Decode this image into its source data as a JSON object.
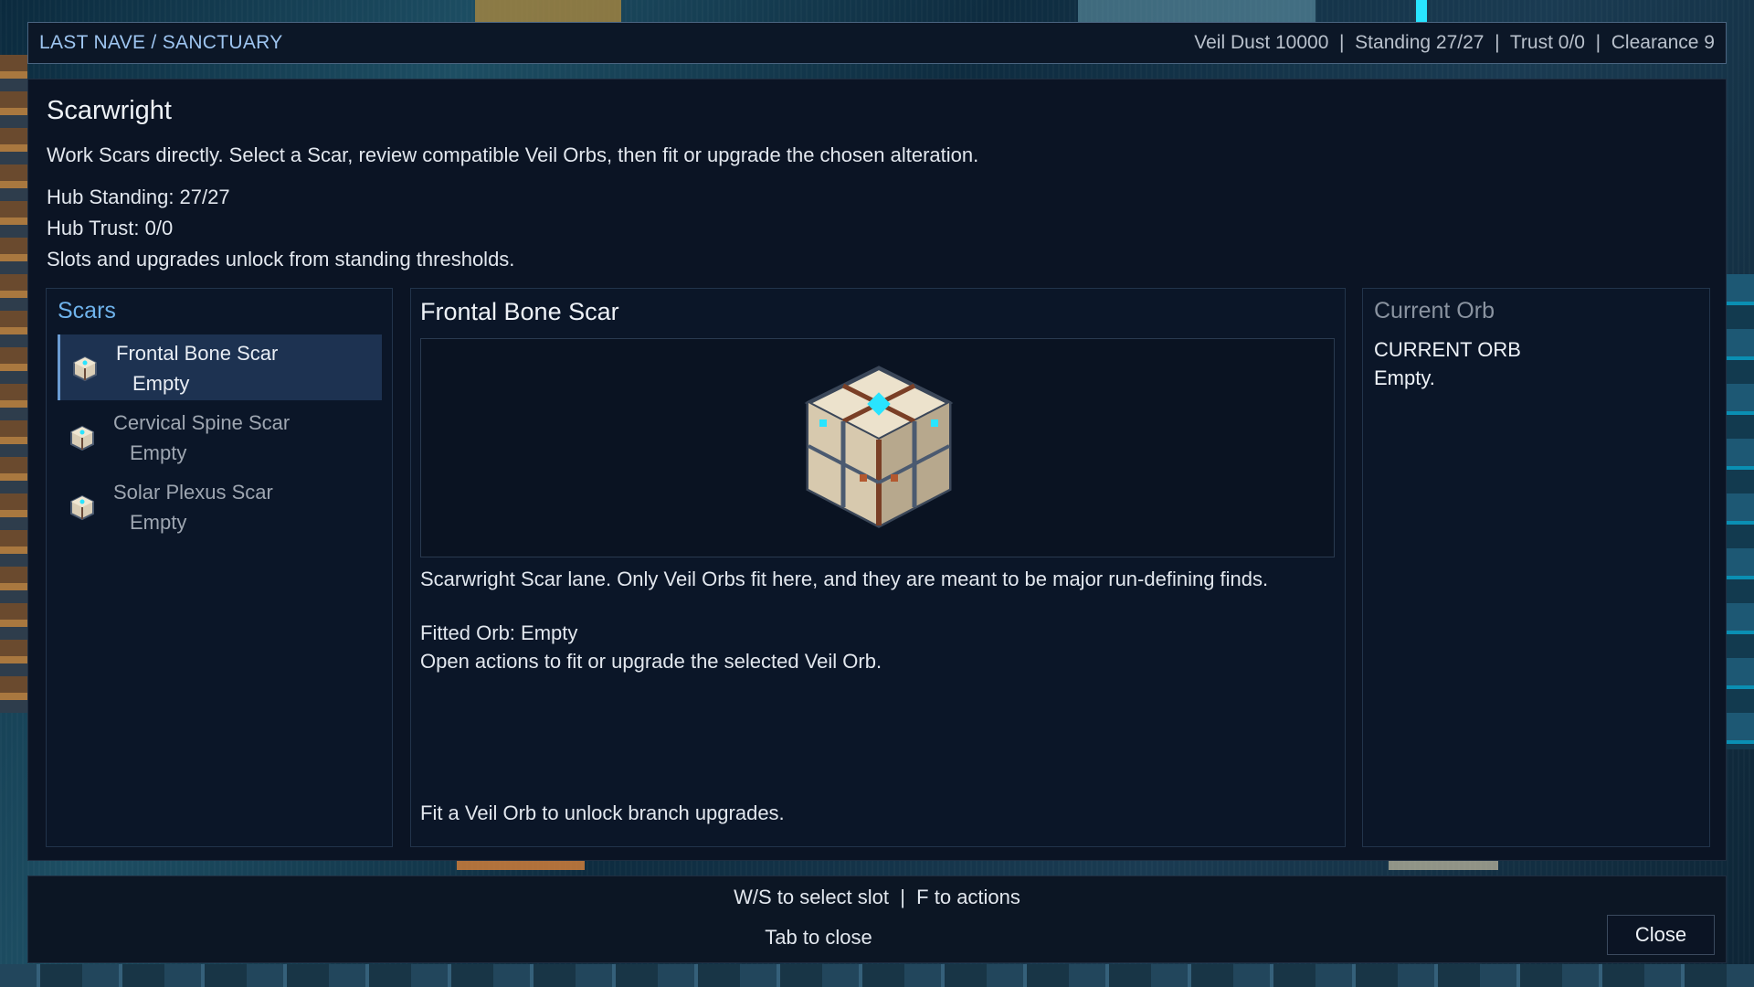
{
  "topbar": {
    "breadcrumb": "LAST NAVE / SANCTUARY",
    "stats": "Veil Dust 10000  |  Standing 27/27  |  Trust 0/0  |  Clearance 9"
  },
  "panel": {
    "title": "Scarwright",
    "description": "Work Scars directly. Select a Scar, review compatible Veil Orbs, then fit or upgrade the chosen alteration.",
    "hub_standing": "Hub Standing: 27/27",
    "hub_trust": "Hub Trust: 0/0",
    "unlock_note": "Slots and upgrades unlock from standing thresholds."
  },
  "scars": {
    "title": "Scars",
    "items": [
      {
        "name": "Frontal Bone Scar",
        "state": "Empty",
        "icon": "veil-orb-cube-icon",
        "selected": true
      },
      {
        "name": "Cervical Spine Scar",
        "state": "Empty",
        "icon": "veil-orb-cube-icon",
        "selected": false
      },
      {
        "name": "Solar Plexus Scar",
        "state": "Empty",
        "icon": "veil-orb-cube-icon",
        "selected": false
      }
    ]
  },
  "detail": {
    "title": "Frontal Bone Scar",
    "artwork": "veil-orb-cube",
    "text1": "Scarwright Scar lane. Only Veil Orbs fit here, and they are meant to be major run-defining finds.",
    "text2": "Fitted Orb: Empty",
    "text3": "Open actions to fit or upgrade the selected Veil Orb.",
    "footer_note": "Fit a Veil Orb to unlock branch upgrades."
  },
  "current_orb": {
    "title": "Current Orb",
    "heading": "CURRENT ORB",
    "value": "Empty."
  },
  "bottombar": {
    "hint_controls": "W/S to select slot  |  F to actions",
    "hint_close": "Tab to close",
    "close_label": "Close"
  },
  "colors": {
    "accent": "#6fb3ec",
    "selection": "#1d3251",
    "panel_bg": "#0b1424",
    "gem": "#29e4ff"
  }
}
